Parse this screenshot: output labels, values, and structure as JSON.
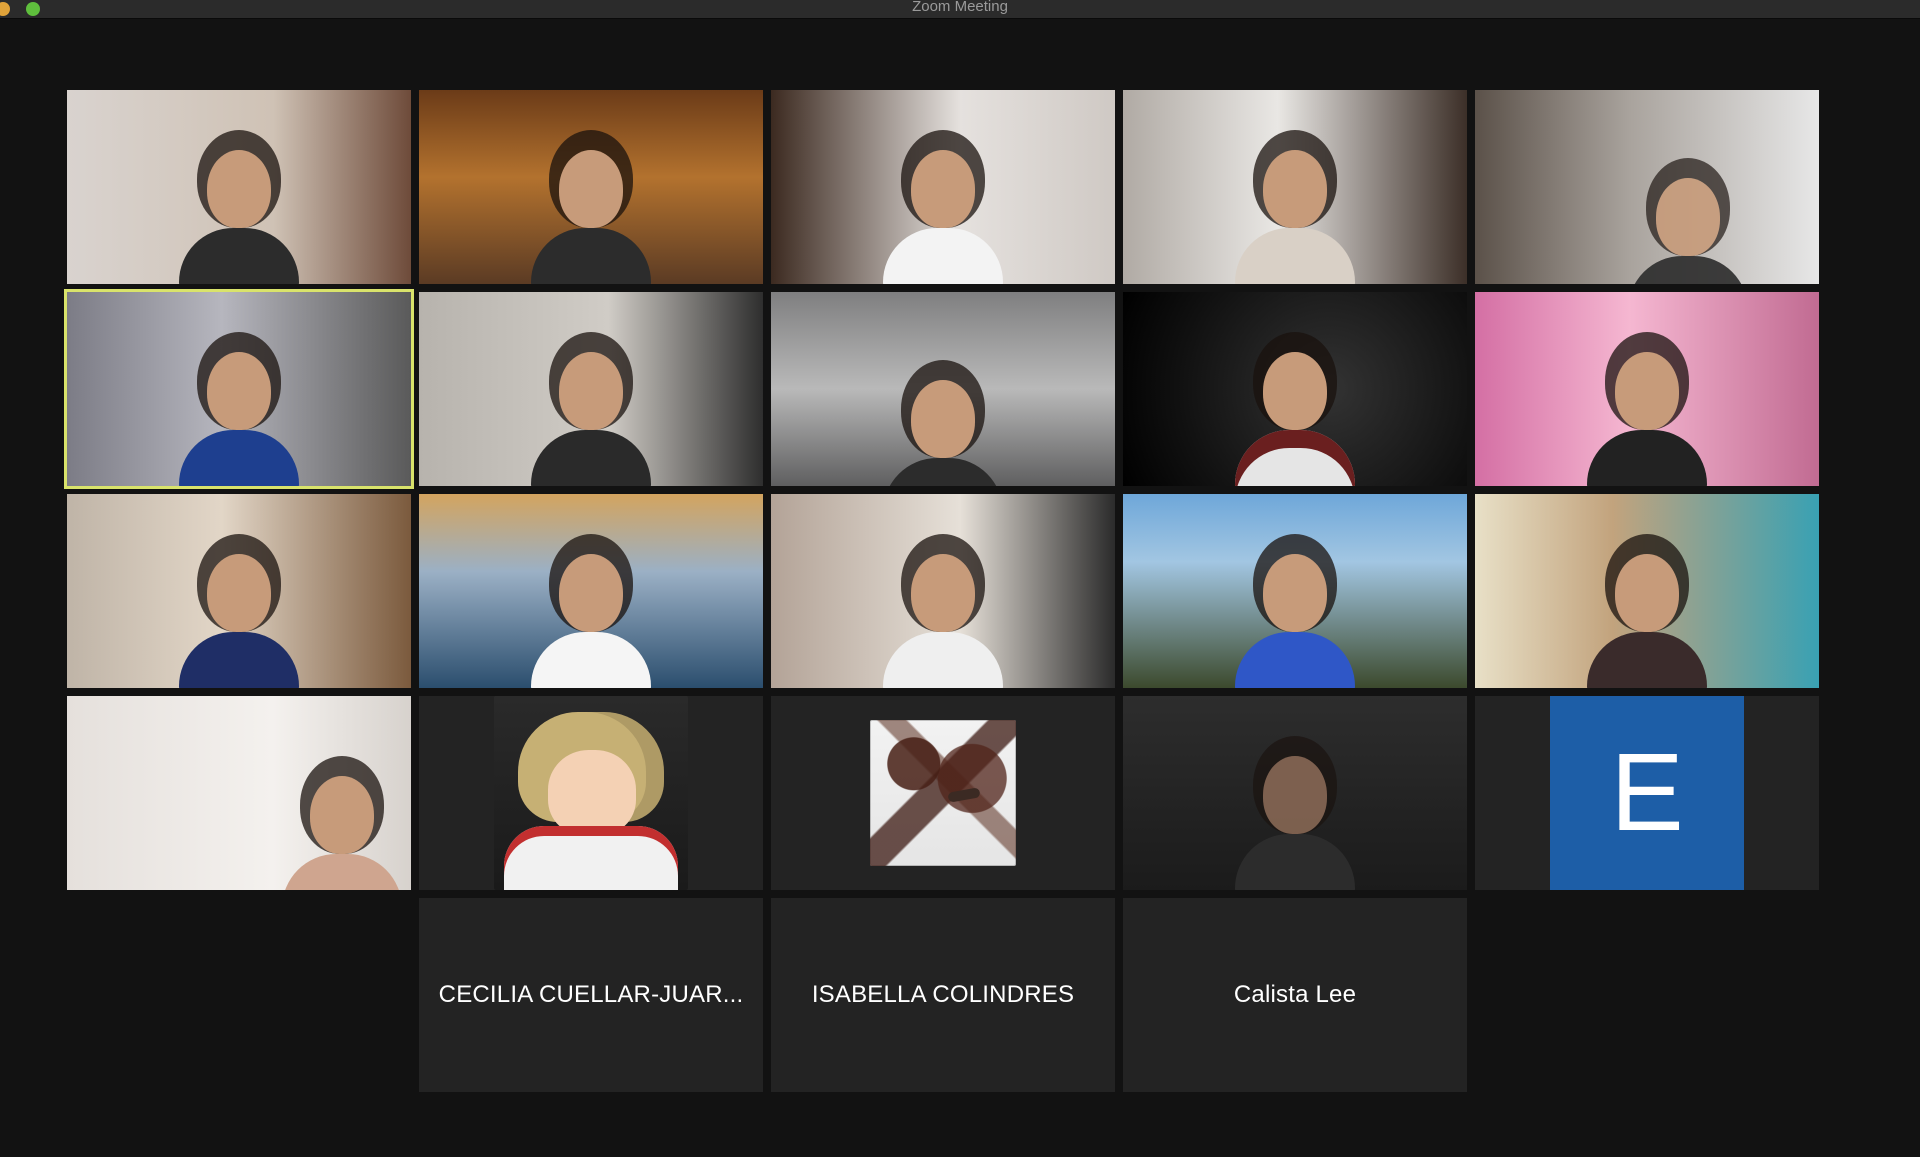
{
  "window": {
    "title": "Zoom Meeting"
  },
  "tiles": {
    "letter_avatar": "E",
    "name_only": [
      {
        "name": "CECILIA CUELLAR-JUAR..."
      },
      {
        "name": "ISABELLA COLINDRES"
      },
      {
        "name": "Calista Lee"
      }
    ]
  },
  "colors": {
    "active_speaker_border": "#d9e36b",
    "letter_avatar_bg": "#1d5ea7",
    "tile_bg": "#232323",
    "app_bg": "#121212"
  }
}
